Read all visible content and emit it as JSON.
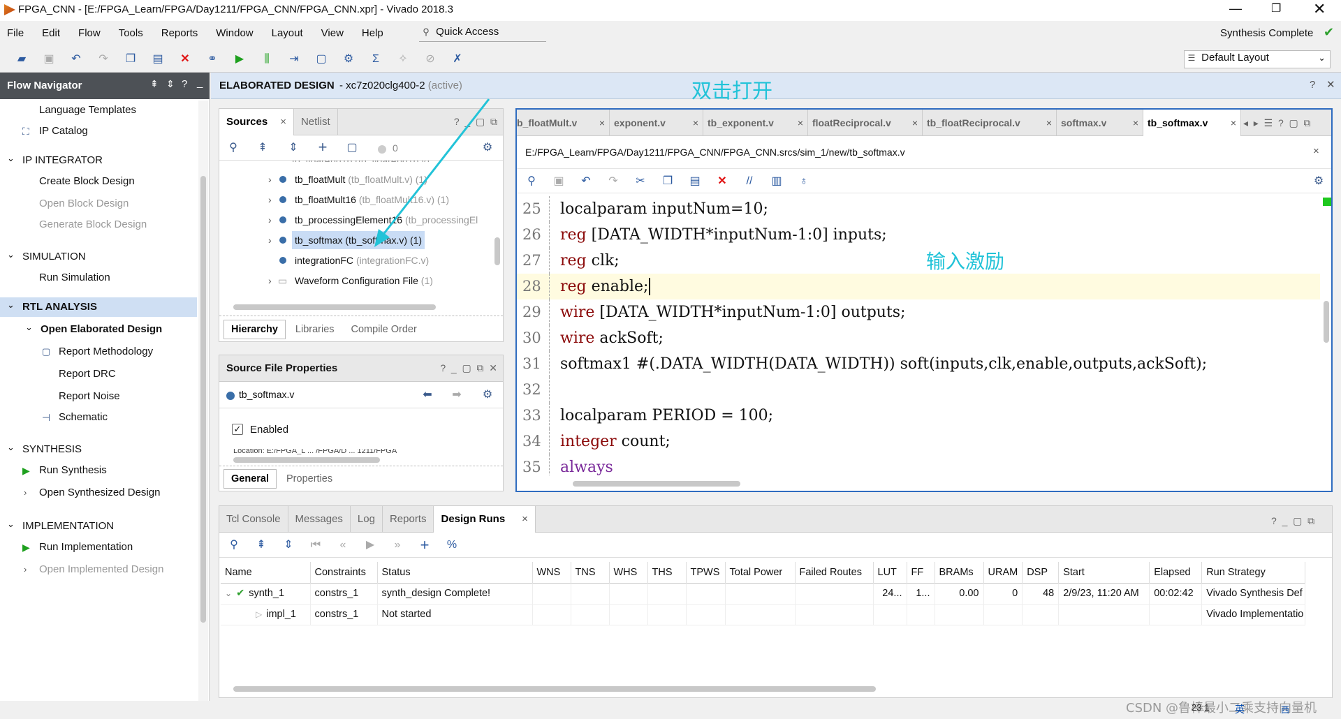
{
  "window": {
    "title": "FPGA_CNN - [E:/FPGA_Learn/FPGA/Day1211/FPGA_CNN/FPGA_CNN.xpr] - Vivado 2018.3"
  },
  "menu": [
    "File",
    "Edit",
    "Flow",
    "Tools",
    "Reports",
    "Window",
    "Layout",
    "View",
    "Help"
  ],
  "quick_access": "Quick Access",
  "status": {
    "synthesis": "Synthesis Complete",
    "check_color": "#2ea02e"
  },
  "layout_select": "Default Layout",
  "flow_navigator": {
    "title": "Flow Navigator",
    "items": [
      {
        "label": "Language Templates",
        "type": "item"
      },
      {
        "label": "IP Catalog",
        "type": "item"
      },
      {
        "label": "IP INTEGRATOR",
        "type": "section"
      },
      {
        "label": "Create Block Design",
        "type": "item"
      },
      {
        "label": "Open Block Design",
        "type": "disabled"
      },
      {
        "label": "Generate Block Design",
        "type": "disabled"
      },
      {
        "label": "SIMULATION",
        "type": "section"
      },
      {
        "label": "Run Simulation",
        "type": "item"
      },
      {
        "label": "RTL ANALYSIS",
        "type": "section-active"
      },
      {
        "label": "Open Elaborated Design",
        "type": "bold"
      },
      {
        "label": "Report Methodology",
        "type": "item"
      },
      {
        "label": "Report DRC",
        "type": "item"
      },
      {
        "label": "Report Noise",
        "type": "item"
      },
      {
        "label": "Schematic",
        "type": "item"
      },
      {
        "label": "SYNTHESIS",
        "type": "section"
      },
      {
        "label": "Run Synthesis",
        "type": "item"
      },
      {
        "label": "Open Synthesized Design",
        "type": "item"
      },
      {
        "label": "IMPLEMENTATION",
        "type": "section"
      },
      {
        "label": "Run Implementation",
        "type": "item"
      },
      {
        "label": "Open Implemented Design",
        "type": "disabled"
      }
    ]
  },
  "design_header": {
    "title": "ELABORATED DESIGN",
    "part": " - xc7z020clg400-2",
    "state": "(active)"
  },
  "annotations": {
    "double_click": "双击打开",
    "input_stimulus": "输入激励"
  },
  "sources": {
    "tabs": [
      "Sources",
      "Netlist"
    ],
    "count": "0",
    "tree": [
      {
        "name": "tb_floatMult",
        "hint": "(tb_floatMult.v) (1)"
      },
      {
        "name": "tb_floatMult16",
        "hint": "(tb_floatMult16.v) (1)"
      },
      {
        "name": "tb_processingElement16",
        "hint": "(tb_processingEl"
      },
      {
        "name": "tb_softmax",
        "hint": "(tb_softmax.v) (1)"
      },
      {
        "name": "integrationFC",
        "hint": "(integrationFC.v)"
      },
      {
        "name": "Waveform Configuration File",
        "hint": "(1)"
      }
    ],
    "bottom_tabs": [
      "Hierarchy",
      "Libraries",
      "Compile Order"
    ]
  },
  "file_props": {
    "title": "Source File Properties",
    "file": "tb_softmax.v",
    "enabled_label": "Enabled",
    "bottom_tabs": [
      "General",
      "Properties"
    ]
  },
  "editor": {
    "tabs": [
      "b_floatMult.v",
      "exponent.v",
      "tb_exponent.v",
      "floatReciprocal.v",
      "tb_floatReciprocal.v",
      "softmax.v",
      "tb_softmax.v"
    ],
    "path": "E:/FPGA_Learn/FPGA/Day1211/FPGA_CNN/FPGA_CNN.srcs/sim_1/new/tb_softmax.v",
    "lines": [
      {
        "n": "25",
        "kw": "",
        "rest": "localparam inputNum=10;"
      },
      {
        "n": "26",
        "kw": "reg",
        "rest": " [DATA_WIDTH*inputNum-1:0] inputs;"
      },
      {
        "n": "27",
        "kw": "reg",
        "rest": " clk;"
      },
      {
        "n": "28",
        "kw": "reg",
        "rest": " enable;"
      },
      {
        "n": "29",
        "kw": "wire",
        "rest": " [DATA_WIDTH*inputNum-1:0] outputs;"
      },
      {
        "n": "30",
        "kw": "wire",
        "rest": " ackSoft;"
      },
      {
        "n": "31",
        "kw": "",
        "rest": "softmax1 #(.DATA_WIDTH(DATA_WIDTH)) soft(inputs,clk,enable,outputs,ackSoft);"
      },
      {
        "n": "32",
        "kw": "",
        "rest": ""
      },
      {
        "n": "33",
        "kw": "",
        "rest": "localparam PERIOD = 100;"
      },
      {
        "n": "34",
        "kw": "integer",
        "rest": " count;"
      },
      {
        "n": "35",
        "kw": "always",
        "rest": ""
      }
    ]
  },
  "console": {
    "tabs": [
      "Tcl Console",
      "Messages",
      "Log",
      "Reports",
      "Design Runs"
    ],
    "columns": [
      "Name",
      "Constraints",
      "Status",
      "WNS",
      "TNS",
      "WHS",
      "THS",
      "TPWS",
      "Total Power",
      "Failed Routes",
      "LUT",
      "FF",
      "BRAMs",
      "URAM",
      "DSP",
      "Start",
      "Elapsed",
      "Run Strategy"
    ],
    "rows": [
      [
        "synth_1",
        "constrs_1",
        "synth_design Complete!",
        "",
        "",
        "",
        "",
        "",
        "",
        "",
        "24...",
        "1...",
        "0.00",
        "0",
        "48",
        "2/9/23, 11:20 AM",
        "00:02:42",
        "Vivado Synthesis Def"
      ],
      [
        "impl_1",
        "constrs_1",
        "Not started",
        "",
        "",
        "",
        "",
        "",
        "",
        "",
        "",
        "",
        "",
        "",
        "",
        "",
        "",
        "Vivado Implementatio"
      ]
    ]
  },
  "watermark": "CSDN @鲁棒最小二乘支持向量机",
  "taskbar": {
    "time": "23:1",
    "ime": "英",
    "ime2": "西"
  }
}
